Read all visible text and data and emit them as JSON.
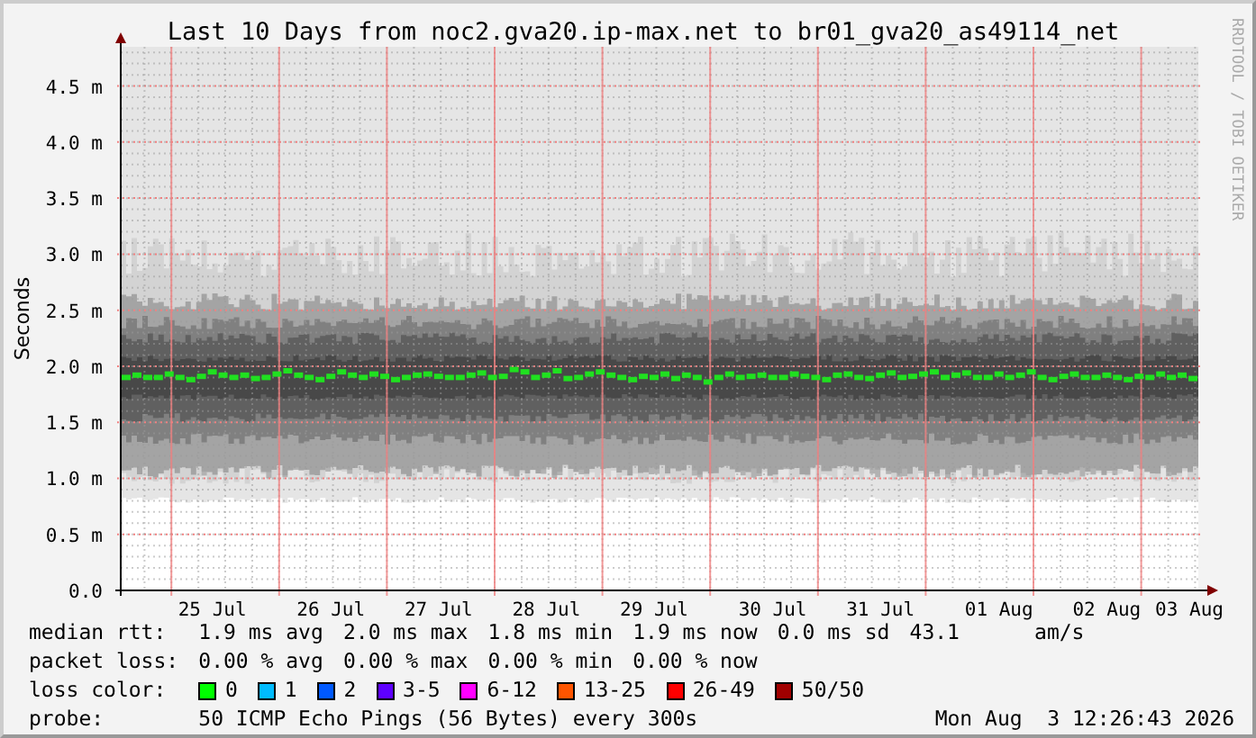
{
  "graph": {
    "title": "Last 10 Days from noc2.gva20.ip-max.net to br01_gva20_as49114_net",
    "credit": "RRDTOOL / TOBI OETIKER",
    "chart_data": {
      "type": "scatter",
      "grid": true,
      "ylabel": "Seconds",
      "ylim": [
        0,
        4.85
      ],
      "categories": [
        null,
        null,
        null,
        null,
        null,
        null,
        null,
        null,
        "25 Jul",
        null,
        null,
        null,
        null,
        null,
        null,
        null,
        null,
        null,
        null,
        "26 Jul",
        null,
        null,
        null,
        null,
        null,
        null,
        null,
        null,
        null,
        "27 Jul",
        null,
        null,
        null,
        null,
        null,
        null,
        null,
        null,
        null,
        "28 Jul",
        null,
        null,
        null,
        null,
        null,
        null,
        null,
        null,
        null,
        "29 Jul",
        null,
        null,
        null,
        null,
        null,
        null,
        null,
        null,
        null,
        null,
        "30 Jul",
        null,
        null,
        null,
        null,
        null,
        null,
        null,
        null,
        null,
        "31 Jul",
        null,
        null,
        null,
        null,
        null,
        null,
        null,
        null,
        null,
        null,
        "01 Aug",
        null,
        null,
        null,
        null,
        null,
        null,
        null,
        null,
        null,
        "02 Aug",
        null,
        null,
        null,
        null,
        null,
        null,
        null,
        "03 Aug"
      ],
      "yticks": [
        {
          "value": 0,
          "label": "0.0"
        },
        {
          "value": 0.5,
          "label": "0.5 m"
        },
        {
          "value": 1,
          "label": "1.0 m"
        },
        {
          "value": 1.5,
          "label": "1.5 m"
        },
        {
          "value": 2,
          "label": "2.0 m"
        },
        {
          "value": 2.5,
          "label": "2.5 m"
        },
        {
          "value": 3,
          "label": "3.0 m"
        },
        {
          "value": 3.5,
          "label": "3.5 m"
        },
        {
          "value": 4,
          "label": "4.0 m"
        },
        {
          "value": 4.5,
          "label": "4.5 m"
        }
      ],
      "series": [
        {
          "color": "#20e020",
          "values": [
            1.9,
            1.92,
            1.9,
            1.9,
            1.93,
            1.9,
            1.88,
            1.91,
            1.95,
            1.92,
            1.9,
            1.92,
            1.89,
            1.9,
            1.93,
            1.96,
            1.92,
            1.9,
            1.88,
            1.91,
            1.95,
            1.92,
            1.9,
            1.93,
            1.91,
            1.88,
            1.9,
            1.92,
            1.93,
            1.91,
            1.9,
            1.9,
            1.92,
            1.94,
            1.9,
            1.91,
            1.97,
            1.95,
            1.9,
            1.92,
            1.96,
            1.89,
            1.9,
            1.93,
            1.95,
            1.92,
            1.9,
            1.88,
            1.91,
            1.9,
            1.93,
            1.89,
            1.92,
            1.9,
            1.86,
            1.9,
            1.93,
            1.9,
            1.91,
            1.92,
            1.9,
            1.9,
            1.93,
            1.91,
            1.9,
            1.88,
            1.92,
            1.93,
            1.9,
            1.89,
            1.92,
            1.94,
            1.9,
            1.91,
            1.93,
            1.95,
            1.9,
            1.92,
            1.94,
            1.9,
            1.9,
            1.93,
            1.9,
            1.92,
            1.95,
            1.9,
            1.88,
            1.91,
            1.93,
            1.9,
            1.9,
            1.92,
            1.9,
            1.88,
            1.91,
            1.9,
            1.93,
            1.9,
            1.92,
            1.89
          ]
        }
      ]
    }
  },
  "legend": [
    {
      "kind": "stats",
      "label": "median rtt:",
      "values": [
        "1.9 ms avg",
        "2.0 ms max",
        "1.8 ms min",
        "1.9 ms now",
        "0.0 ms sd",
        "43.1      am/s"
      ]
    },
    {
      "kind": "stats",
      "label": "packet loss:",
      "values": [
        "0.00 % avg",
        "0.00 % max",
        "0.00 % min",
        "0.00 % now"
      ]
    },
    {
      "kind": "colors",
      "label": "loss color:",
      "items": [
        {
          "label": "0",
          "color": "#00ff00"
        },
        {
          "label": "1",
          "color": "#00bbff"
        },
        {
          "label": "2",
          "color": "#0059ff"
        },
        {
          "label": "3-5",
          "color": "#5e00ff"
        },
        {
          "label": "6-12",
          "color": "#ff00ff"
        },
        {
          "label": "13-25",
          "color": "#ff5500"
        },
        {
          "label": "26-49",
          "color": "#ff0000"
        },
        {
          "label": "50/50",
          "color": "#a10000"
        }
      ]
    },
    {
      "kind": "probe",
      "label": "probe:",
      "text": "50 ICMP Echo Pings (56 Bytes) every 300s",
      "date": "Mon Aug  3 12:26:43 2026"
    }
  ]
}
